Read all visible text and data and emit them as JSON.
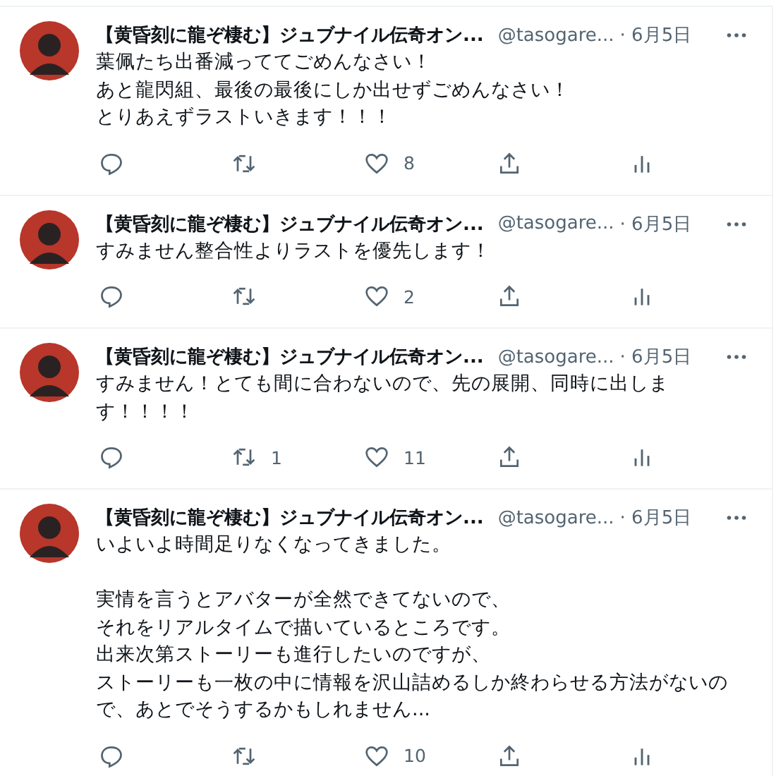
{
  "tweets": [
    {
      "name": "【黄昏刻に龍ぞ棲む】ジュブナイル伝奇オン...",
      "handle": "@tasogare...",
      "date": "· 6月5日",
      "paragraphs": [
        [
          "葉佩たち出番減っててごめんなさい！",
          "あと龍閃組、最後の最後にしか出せずごめんなさい！",
          "とりあえずラストいきます！！！"
        ]
      ],
      "likes": "8"
    },
    {
      "name": "【黄昏刻に龍ぞ棲む】ジュブナイル伝奇オン...",
      "handle": "@tasogare...",
      "date": "· 6月5日",
      "paragraphs": [
        [
          "すみません整合性よりラストを優先します！"
        ]
      ],
      "likes": "2"
    },
    {
      "name": "【黄昏刻に龍ぞ棲む】ジュブナイル伝奇オン...",
      "handle": "@tasogare...",
      "date": "· 6月5日",
      "paragraphs": [
        [
          "すみません！とても間に合わないので、先の展開、同時に出しま",
          "す！！！！"
        ]
      ],
      "retweets": "1",
      "likes": "11"
    },
    {
      "name": "【黄昏刻に龍ぞ棲む】ジュブナイル伝奇オン...",
      "handle": "@tasogare...",
      "date": "· 6月5日",
      "paragraphs": [
        [
          "いよいよ時間足りなくなってきました。"
        ],
        [
          "実情を言うとアバターが全然できてないので、",
          "それをリアルタイムで描いているところです。",
          "出来次第ストーリーも進行したいのですが、",
          "ストーリーも一枚の中に情報を沢山詰めるしか終わらせる方法がないの",
          "で、あとでそうするかもしれません..."
        ]
      ],
      "likes": "10"
    }
  ]
}
